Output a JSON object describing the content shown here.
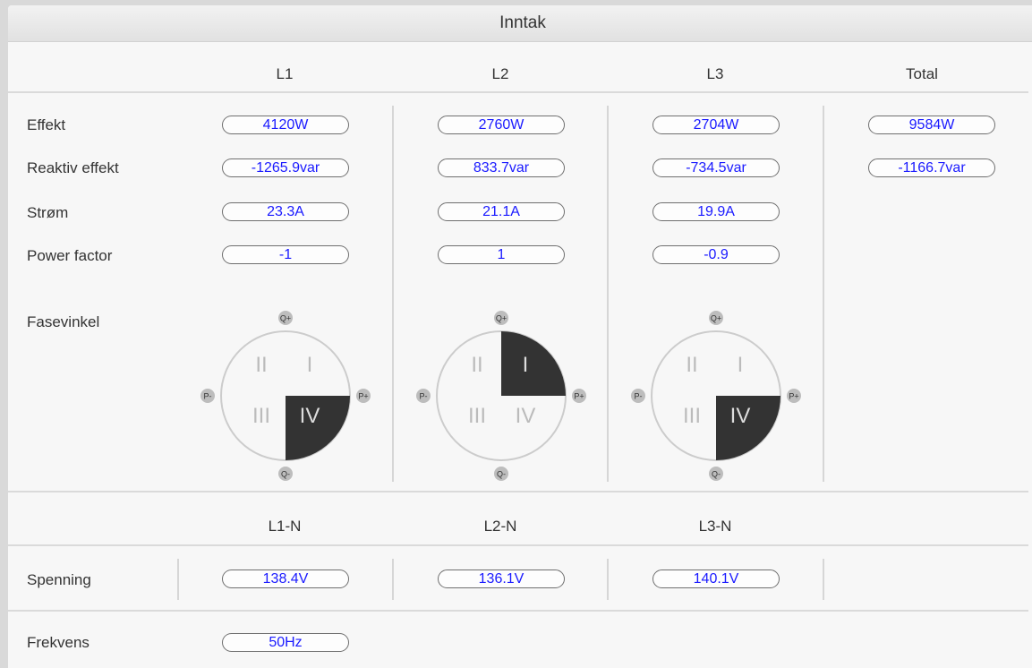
{
  "title": "Inntak",
  "columns": [
    "L1",
    "L2",
    "L3",
    "Total"
  ],
  "rows": {
    "effekt": {
      "label": "Effekt",
      "values": [
        "4120W",
        "2760W",
        "2704W",
        "9584W"
      ]
    },
    "reaktiv": {
      "label": "Reaktiv effekt",
      "values": [
        "-1265.9var",
        "833.7var",
        "-734.5var",
        "-1166.7var"
      ]
    },
    "strom": {
      "label": "Strøm",
      "values": [
        "23.3A",
        "21.1A",
        "19.9A"
      ]
    },
    "pf": {
      "label": "Power factor",
      "values": [
        "-1",
        "1",
        "-0.9"
      ]
    }
  },
  "fasevinkel": {
    "label": "Fasevinkel",
    "axis_labels": {
      "top": "Q+",
      "bottom": "Q-",
      "left": "P-",
      "right": "P+"
    },
    "quadrants": [
      "I",
      "II",
      "III",
      "IV"
    ],
    "active_quadrant": [
      "IV",
      "I",
      "IV"
    ],
    "colors": {
      "active": "#333333",
      "inactive_text": "#bbbbbb",
      "circle": "#cccccc"
    }
  },
  "voltage_columns": [
    "L1-N",
    "L2-N",
    "L3-N"
  ],
  "spenning": {
    "label": "Spenning",
    "values": [
      "138.4V",
      "136.1V",
      "140.1V"
    ]
  },
  "frekvens": {
    "label": "Frekvens",
    "value": "50Hz"
  },
  "colors": {
    "value_text": "#1a1aff",
    "panel_bg": "#f7f7f7"
  }
}
